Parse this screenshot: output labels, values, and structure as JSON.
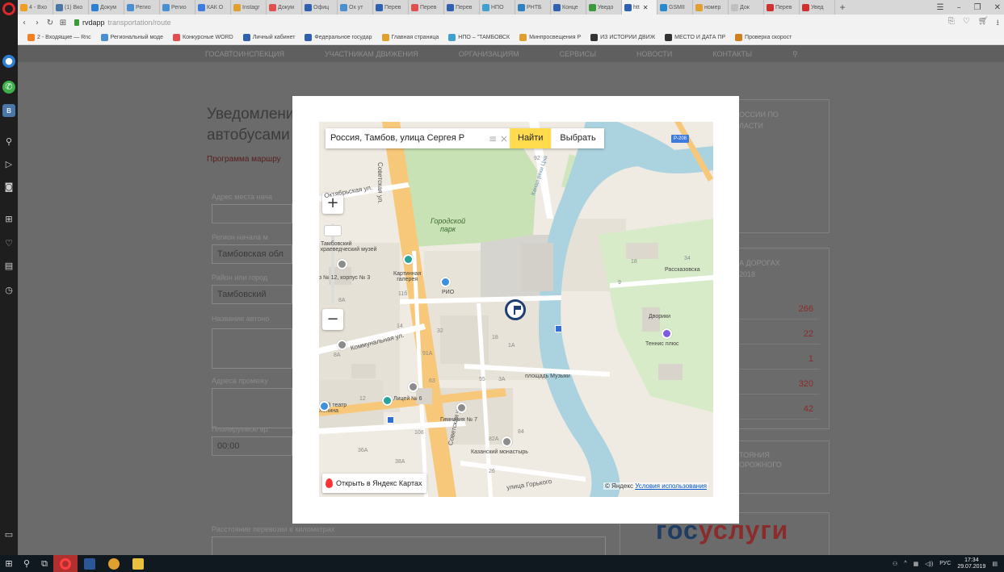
{
  "browser": {
    "tabs": [
      {
        "label": "4 - Вхо",
        "color": "#f0a020"
      },
      {
        "label": "(1) Вко",
        "color": "#4a76a8"
      },
      {
        "label": "Докум",
        "color": "#2d7fd3"
      },
      {
        "label": "Регио",
        "color": "#4a90d0"
      },
      {
        "label": "Регио",
        "color": "#4a90d0"
      },
      {
        "label": "КАК О",
        "color": "#3d7be0"
      },
      {
        "label": "Instagr",
        "color": "#e0a030"
      },
      {
        "label": "Докум",
        "color": "#e05050"
      },
      {
        "label": "Офиц",
        "color": "#3060b0"
      },
      {
        "label": "Ох ут",
        "color": "#4a90d0"
      },
      {
        "label": "Перев",
        "color": "#3060b0"
      },
      {
        "label": "Перев",
        "color": "#e05050"
      },
      {
        "label": "Перев",
        "color": "#3060b0"
      },
      {
        "label": "НПО",
        "color": "#40a0d0"
      },
      {
        "label": "РНТБ",
        "color": "#3080c0"
      },
      {
        "label": "Конце",
        "color": "#3060b0"
      },
      {
        "label": "Уведо",
        "color": "#3c9a3c"
      },
      {
        "label": "htt",
        "color": "#3060b0",
        "active": true
      },
      {
        "label": "GSMII",
        "color": "#2a8ad0"
      },
      {
        "label": "номер",
        "color": "#e0a030"
      },
      {
        "label": "Док",
        "color": "#c0c0c0"
      },
      {
        "label": "Перев",
        "color": "#d03030"
      },
      {
        "label": "Увед",
        "color": "#d03030"
      }
    ],
    "url_domain": "rvdapp",
    "url_path": "transportation/route",
    "bookmarks": [
      {
        "label": "2 - Входящие — Rnc",
        "color": "#f08020"
      },
      {
        "label": "Региональный моде",
        "color": "#4a90d0"
      },
      {
        "label": "Конкурсные WORD",
        "color": "#e05050"
      },
      {
        "label": "Личный кабинет",
        "color": "#3060b0"
      },
      {
        "label": "Федеральное государ",
        "color": "#3060b0"
      },
      {
        "label": "Главная страница",
        "color": "#e0a030"
      },
      {
        "label": "НПО – \"ТАМБОВСК",
        "color": "#40a0d0"
      },
      {
        "label": "Минпросвещения Р",
        "color": "#e0a030"
      },
      {
        "label": "ИЗ ИСТОРИИ ДВИЖ",
        "color": "#333333"
      },
      {
        "label": "МЕСТО И ДАТА ПР",
        "color": "#333333"
      },
      {
        "label": "Проверка скорост",
        "color": "#d08020"
      }
    ]
  },
  "page": {
    "nav": [
      "ГОСАВТОИНСПЕКЦИЯ",
      "УЧАСТНИКАМ ДВИЖЕНИЯ",
      "ОРГАНИЗАЦИЯМ",
      "СЕРВИСЫ",
      "НОВОСТИ",
      "КОНТАКТЫ"
    ],
    "title_line1": "Уведомления",
    "title_line2": "автобусами",
    "program_label": "Программа маршру",
    "fields": [
      {
        "label": "Адрес места нача",
        "value": ""
      },
      {
        "label": "Регион начала м",
        "value": "Тамбовская обл"
      },
      {
        "label": "Район или город",
        "value": "Тамбовский"
      },
      {
        "label": "Название автоно",
        "value": ""
      },
      {
        "label": "Адреса промежу",
        "value": ""
      },
      {
        "label": "Планируемое вр",
        "value": "00:00"
      },
      {
        "label": "Расстояние перевозки в километрах",
        "value": ""
      }
    ],
    "right_card_1": [
      "ОССИИ ПО",
      "ЛАСТИ"
    ],
    "right_card_2": [
      "А ДОРОГАХ",
      "2018"
    ],
    "stats": [
      "266",
      "22",
      "1",
      "320",
      "42"
    ],
    "right_card_3": [
      "ТОЯНИЯ",
      "ОРОЖНОГО"
    ],
    "gosuslugi_a": "гос",
    "gosuslugi_b": "услуги"
  },
  "map": {
    "search_value": "Россия, Тамбов, улица Сергея Р",
    "find_label": "Найти",
    "choose_label": "Выбрать",
    "zoom_in": "+",
    "zoom_out": "−",
    "open_label": "Открыть в Яндекс Картах",
    "copyright": "© Яндекс",
    "terms": "Условия использования",
    "road_badge": "Р-208",
    "labels": {
      "park": "Городской\nпарк",
      "museum": "Тамбовский\nкраеведческий музей",
      "gallery": "Картинная\nгалерея",
      "addr": "з № 12, корпус № 3",
      "rio": "РИО",
      "lyceum": "Лицей № 6",
      "gymnasium": "Гимназия № 7",
      "monastery": "Казанский монастырь",
      "theatre": "ский театр\nЛенина",
      "square": "площадь Музыки",
      "rasskazovska": "Рассказовска",
      "dvoriki": "Дворики",
      "tennis": "Теннис плюс",
      "kanal": "Канал реки Цна",
      "sovetskaya": "Советская ул.",
      "sovetskaya_top": "Советская ул.",
      "oktyabrskaya": "Октябрьская ул.",
      "kommunalnaya": "Коммунальная ул.",
      "gorkogo": "улица Горького",
      "numbers": [
        "92",
        "34",
        "18",
        "9",
        "11б",
        "8А",
        "14",
        "32",
        "18",
        "1А",
        "91А",
        "63",
        "55",
        "3А",
        "12",
        "108",
        "36А",
        "38А",
        "82А",
        "26",
        "84",
        "8А"
      ]
    }
  },
  "taskbar": {
    "clock_time": "17:34",
    "clock_date": "29.07.2019",
    "lang": "РУС"
  }
}
